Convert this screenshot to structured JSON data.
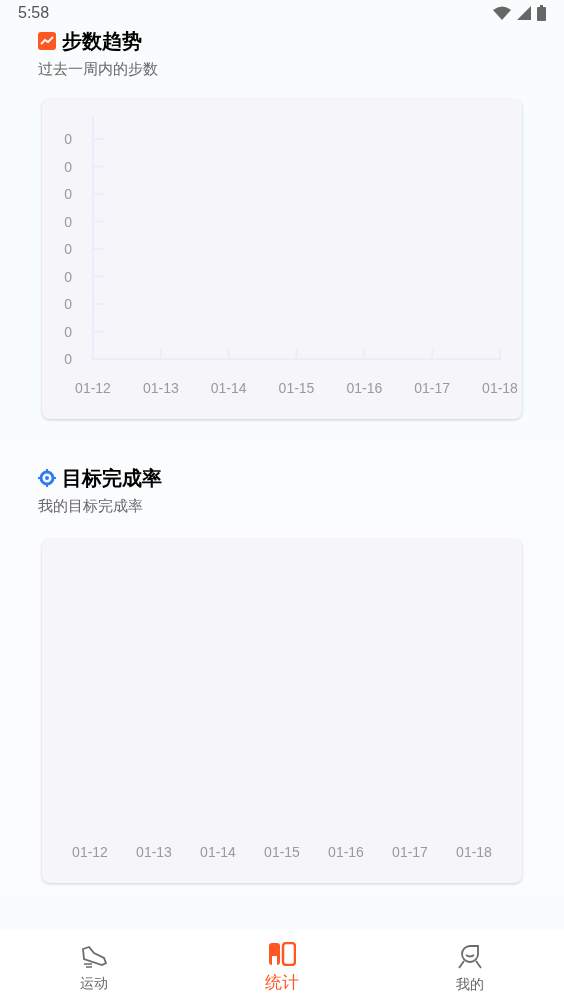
{
  "status_bar": {
    "time": "5:58"
  },
  "sections": [
    {
      "kind": "trend",
      "title": "步数趋势",
      "subtitle": "过去一周内的步数",
      "y_labels": [
        "0",
        "0",
        "0",
        "0",
        "0",
        "0",
        "0",
        "0",
        "0"
      ],
      "x_labels": [
        "01-12",
        "01-13",
        "01-14",
        "01-15",
        "01-16",
        "01-17",
        "01-18"
      ]
    },
    {
      "kind": "target",
      "title": "目标完成率",
      "subtitle": "我的目标完成率",
      "x_labels": [
        "01-12",
        "01-13",
        "01-14",
        "01-15",
        "01-16",
        "01-17",
        "01-18"
      ]
    }
  ],
  "tabs": [
    {
      "kind": "shoe",
      "label": "运动",
      "selected": false
    },
    {
      "kind": "chart",
      "label": "统计",
      "selected": true
    },
    {
      "kind": "person",
      "label": "我的",
      "selected": false
    }
  ]
}
